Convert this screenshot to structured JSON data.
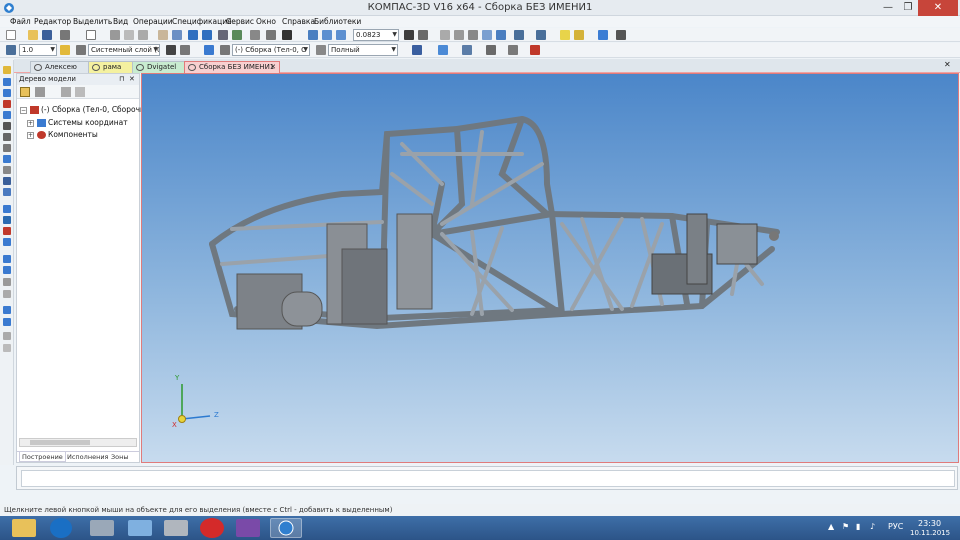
{
  "window": {
    "title": "КОМПАС-3D V16  x64 - Сборка БЕЗ ИМЕНИ1"
  },
  "menu": [
    "Файл",
    "Редактор",
    "Выделить",
    "Вид",
    "Операции",
    "Спецификация",
    "Сервис",
    "Окно",
    "Справка",
    "Библиотеки"
  ],
  "toolbar": {
    "zoom_value": "0.0823",
    "style_combo": "(-) Сборка (Тел-0, С",
    "layer_combo": "Системный слой (0)",
    "display_combo": "Полный",
    "scale_combo": "1.0"
  },
  "tabs": [
    {
      "label": "Алексею",
      "color": "#dfe6ec"
    },
    {
      "label": "рама",
      "color": "#f4f1a0"
    },
    {
      "label": "Dvigatel",
      "color": "#c8ecd0"
    },
    {
      "label": "Сборка БЕЗ ИМЕНИ1",
      "color": "#f8d0d0"
    }
  ],
  "tree": {
    "header": "Дерево модели",
    "root": "(-) Сборка (Тел-0, Сборочны",
    "items": [
      "Системы координат",
      "Компоненты"
    ],
    "tabs": [
      "Построение",
      "Исполнения",
      "Зоны"
    ]
  },
  "viewport": {
    "axis": {
      "x": "X",
      "y": "Y",
      "z": "Z"
    }
  },
  "status": "Щелкните левой кнопкой мыши на объекте для его выделения (вместе с Ctrl - добавить к выделенным)",
  "tray": {
    "lang": "РУС",
    "time": "23:30",
    "date": "10.11.2015"
  }
}
